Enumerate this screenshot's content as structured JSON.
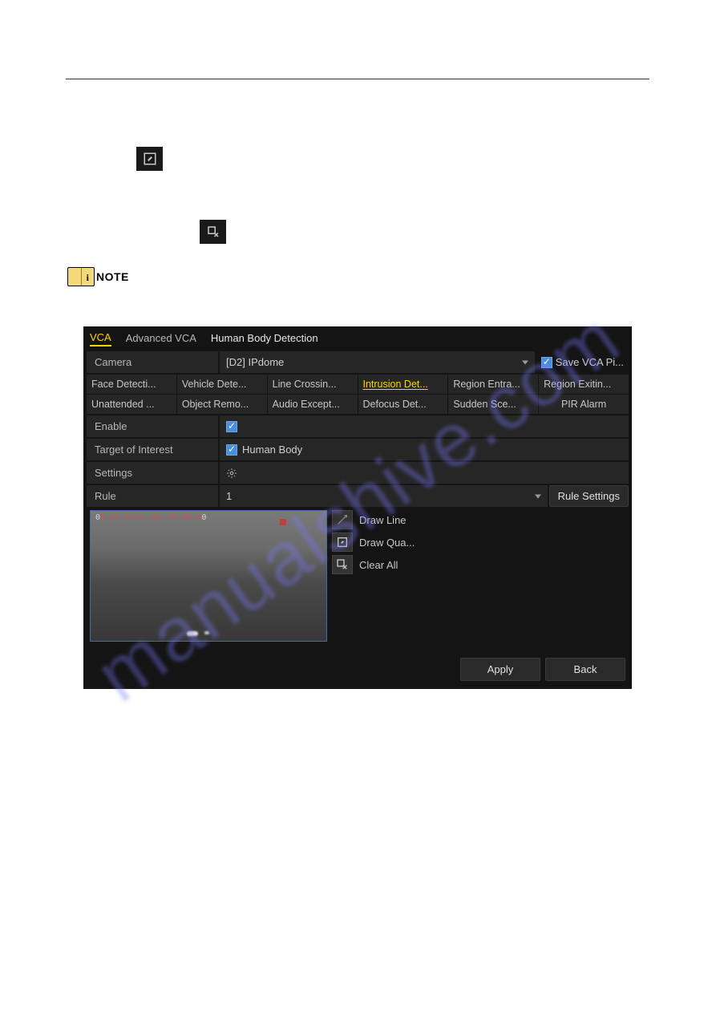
{
  "note_label": "NOTE",
  "watermark": "manualshive.com",
  "tabs": {
    "vca": "VCA",
    "advanced": "Advanced VCA",
    "human": "Human Body Detection"
  },
  "camera_label": "Camera",
  "camera_value": "[D2] IPdome",
  "save_vca": "Save VCA Pi...",
  "detections": {
    "face": "Face Detecti...",
    "vehicle": "Vehicle Dete...",
    "line": "Line Crossin...",
    "intrusion": "Intrusion Det...",
    "region_entra": "Region Entra...",
    "region_exit": "Region Exitin...",
    "unattended": "Unattended ...",
    "object": "Object Remo...",
    "audio": "Audio Except...",
    "defocus": "Defocus Det...",
    "sudden": "Sudden Sce...",
    "pir": "PIR Alarm"
  },
  "enable_label": "Enable",
  "target_label": "Target of Interest",
  "target_value": "Human Body",
  "settings_label": "Settings",
  "rule_label": "Rule",
  "rule_value": "1",
  "rule_settings_btn": "Rule Settings",
  "draw_line": "Draw Line",
  "draw_quad": "Draw Qua...",
  "clear_all": "Clear All",
  "timestamp_part1": "0",
  "timestamp_part2": "5-25-2017 Thu 20:05:4",
  "timestamp_part3": "0",
  "apply_btn": "Apply",
  "back_btn": "Back"
}
